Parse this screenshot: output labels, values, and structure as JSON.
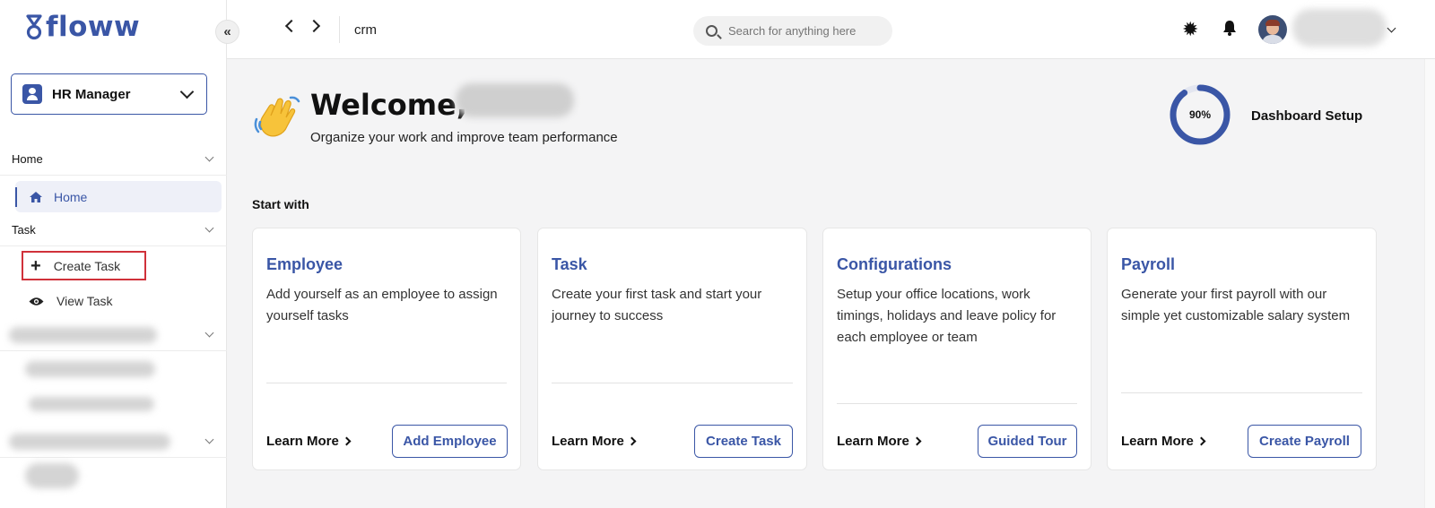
{
  "brand": {
    "name": "floww",
    "color": "#3a56a6"
  },
  "sidebar": {
    "role": "HR Manager",
    "sections": [
      {
        "label": "Home"
      },
      {
        "label": "Task"
      }
    ],
    "items": [
      {
        "label": "Home",
        "icon": "home-icon",
        "active": true
      },
      {
        "label": "Create Task",
        "icon": "plus-icon",
        "highlighted": true
      },
      {
        "label": "View Task",
        "icon": "eye-icon"
      }
    ]
  },
  "topbar": {
    "breadcrumb": "crm",
    "search_placeholder": "Search for anything here"
  },
  "main": {
    "welcome": "Welcome,",
    "subtitle": "Organize your work and improve team performance",
    "setup_progress": "90%",
    "setup_progress_value": 0.9,
    "setup_label": "Dashboard Setup",
    "start_with": "Start with",
    "cards": [
      {
        "title": "Employee",
        "description": "Add yourself as an employee to assign yourself tasks",
        "learn_more": "Learn More",
        "button": "Add Employee"
      },
      {
        "title": "Task",
        "description": "Create your first task and start your journey to success",
        "learn_more": "Learn More",
        "button": "Create Task"
      },
      {
        "title": "Configurations",
        "description": "Setup your office locations, work timings, holidays and leave policy for each employee or team",
        "learn_more": "Learn More",
        "button": "Guided Tour"
      },
      {
        "title": "Payroll",
        "description": "Generate your first payroll with our simple yet customizable salary system",
        "learn_more": "Learn More",
        "button": "Create Payroll"
      }
    ]
  }
}
